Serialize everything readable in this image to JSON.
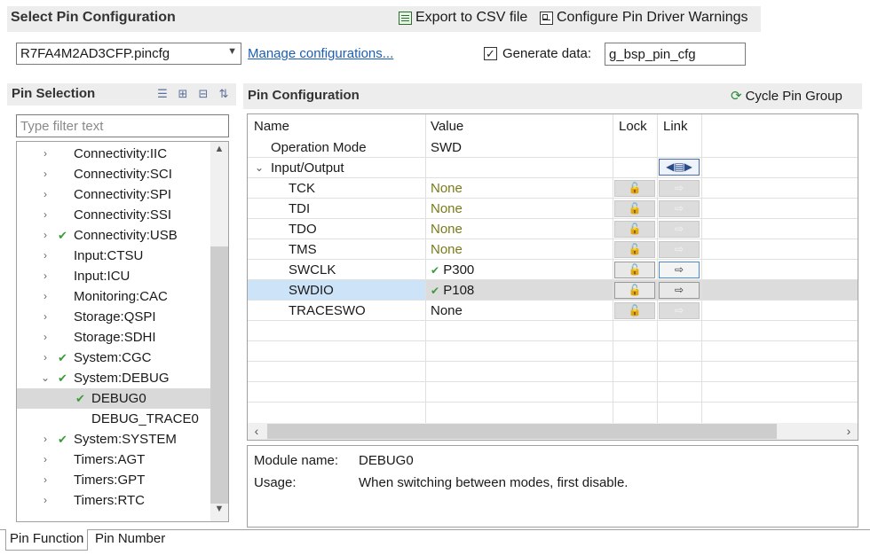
{
  "header": {
    "title": "Select Pin Configuration",
    "export_label": "Export to CSV file",
    "warnings_label": "Configure Pin Driver Warnings"
  },
  "config": {
    "file": "R7FA4M2AD3CFP.pincfg",
    "manage_link": "Manage configurations...",
    "generate_checked": true,
    "generate_label": "Generate data:",
    "generate_value": "g_bsp_pin_cfg"
  },
  "pin_selection": {
    "title": "Pin Selection",
    "filter_placeholder": "Type filter text",
    "items": [
      {
        "label": "Connectivity:IIC",
        "checked": false
      },
      {
        "label": "Connectivity:SCI",
        "checked": false
      },
      {
        "label": "Connectivity:SPI",
        "checked": false
      },
      {
        "label": "Connectivity:SSI",
        "checked": false
      },
      {
        "label": "Connectivity:USB",
        "checked": true
      },
      {
        "label": "Input:CTSU",
        "checked": false
      },
      {
        "label": "Input:ICU",
        "checked": false
      },
      {
        "label": "Monitoring:CAC",
        "checked": false
      },
      {
        "label": "Storage:QSPI",
        "checked": false
      },
      {
        "label": "Storage:SDHI",
        "checked": false
      },
      {
        "label": "System:CGC",
        "checked": true
      },
      {
        "label": "System:DEBUG",
        "checked": true,
        "expanded": true
      },
      {
        "label": "DEBUG0",
        "checked": true,
        "child": true,
        "selected": true
      },
      {
        "label": "DEBUG_TRACE0",
        "checked": false,
        "child": true
      },
      {
        "label": "System:SYSTEM",
        "checked": true
      },
      {
        "label": "Timers:AGT",
        "checked": false
      },
      {
        "label": "Timers:GPT",
        "checked": false
      },
      {
        "label": "Timers:RTC",
        "checked": false
      }
    ]
  },
  "pin_config": {
    "title": "Pin Configuration",
    "cycle_label": "Cycle Pin Group",
    "columns": {
      "name": "Name",
      "value": "Value",
      "lock": "Lock",
      "link": "Link"
    },
    "rows": [
      {
        "name": "Operation Mode",
        "value": "SWD"
      },
      {
        "name": "Input/Output",
        "value": ""
      },
      {
        "name": "TCK",
        "value": "None"
      },
      {
        "name": "TDI",
        "value": "None"
      },
      {
        "name": "TDO",
        "value": "None"
      },
      {
        "name": "TMS",
        "value": "None"
      },
      {
        "name": "SWCLK",
        "value": "P300",
        "checked": true
      },
      {
        "name": "SWDIO",
        "value": "P108",
        "checked": true
      },
      {
        "name": "TRACESWO",
        "value": "None"
      }
    ]
  },
  "info": {
    "module_label": "Module name:",
    "module_value": "DEBUG0",
    "usage_label": "Usage:",
    "usage_value": "When switching between modes, first disable."
  },
  "tabs": {
    "pin_function": "Pin Function",
    "pin_number": "Pin Number"
  }
}
